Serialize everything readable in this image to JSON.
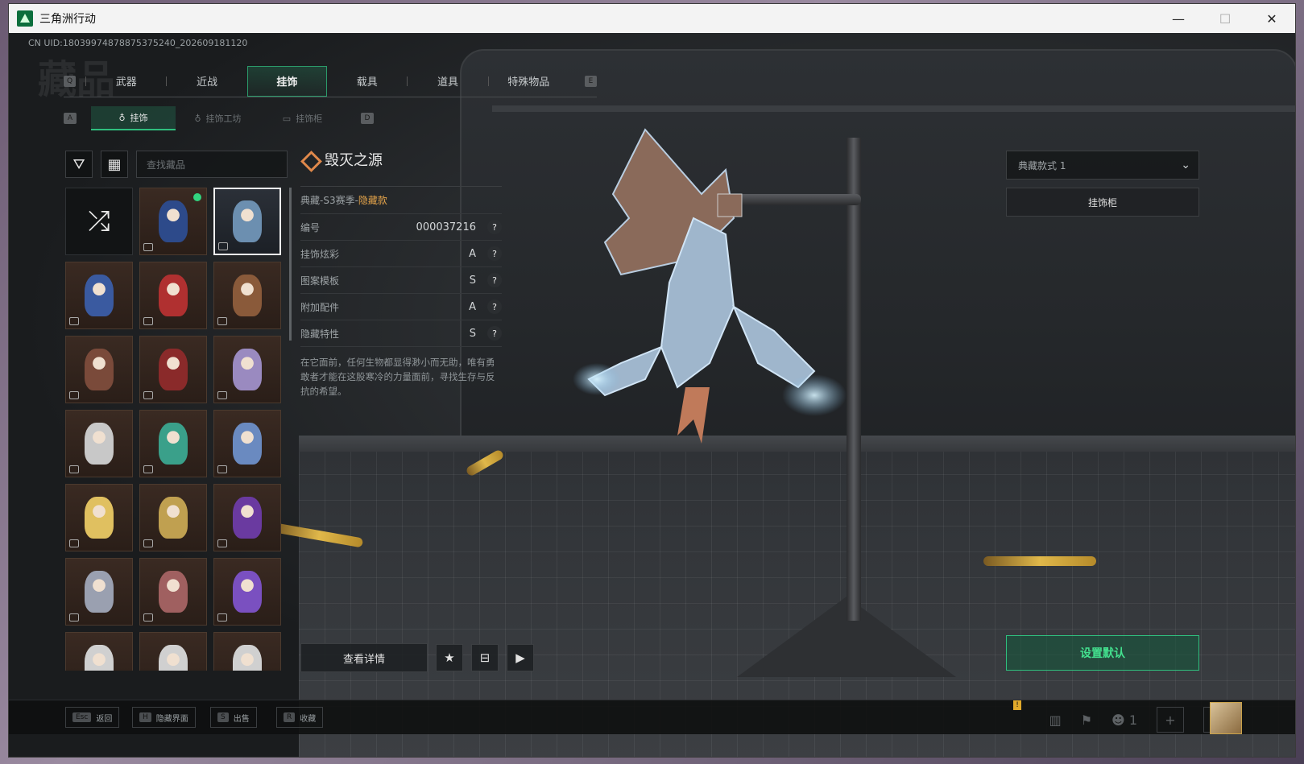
{
  "window": {
    "title": "三角洲行动",
    "controls": {
      "minimize": "—",
      "maximize": "☐",
      "close": "✕"
    }
  },
  "uid": "CN UID:18039974878875375240_202609181120",
  "bg_title": "藏品",
  "main_tabs": {
    "left_key": "Q",
    "right_key": "E",
    "items": [
      {
        "label": "武器",
        "active": false
      },
      {
        "label": "近战",
        "active": false
      },
      {
        "label": "挂饰",
        "active": true
      },
      {
        "label": "载具",
        "active": false
      },
      {
        "label": "道具",
        "active": false
      },
      {
        "label": "特殊物品",
        "active": false
      }
    ]
  },
  "sub_tabs": {
    "left_key": "A",
    "right_key": "D",
    "items": [
      {
        "label": "挂饰",
        "icon": "charm-icon",
        "active": true
      },
      {
        "label": "挂饰工坊",
        "icon": "charm-icon",
        "active": false
      },
      {
        "label": "挂饰柜",
        "icon": "cabinet-icon",
        "active": false
      }
    ]
  },
  "toolbar": {
    "filter_icon": "filter-icon",
    "layout_icon": "grid-layout-icon",
    "search_placeholder": "查找藏品"
  },
  "grid": {
    "items": [
      {
        "kind": "random",
        "icon": "shuffle-icon"
      },
      {
        "kind": "charm",
        "color": "#2d4a8a",
        "equipped": true
      },
      {
        "kind": "charm",
        "color": "#6c8fb0",
        "selected": true
      },
      {
        "kind": "charm",
        "color": "#3a5aa0"
      },
      {
        "kind": "charm",
        "color": "#b03030"
      },
      {
        "kind": "charm",
        "color": "#8a5a3a"
      },
      {
        "kind": "charm",
        "color": "#7a4a3a"
      },
      {
        "kind": "charm",
        "color": "#8a2a2a"
      },
      {
        "kind": "charm",
        "color": "#9a8ac0"
      },
      {
        "kind": "charm",
        "color": "#c8c8c8"
      },
      {
        "kind": "charm",
        "color": "#3aa08a"
      },
      {
        "kind": "charm",
        "color": "#6a8ac0"
      },
      {
        "kind": "charm",
        "color": "#e0c060"
      },
      {
        "kind": "charm",
        "color": "#c0a050"
      },
      {
        "kind": "charm",
        "color": "#6a3aa0"
      },
      {
        "kind": "charm",
        "color": "#9aa0b0"
      },
      {
        "kind": "charm",
        "color": "#a06060"
      },
      {
        "kind": "charm",
        "color": "#7a50c0"
      },
      {
        "kind": "charm",
        "color": "#d0d0d0"
      },
      {
        "kind": "charm",
        "color": "#d0d0d0"
      },
      {
        "kind": "charm",
        "color": "#d0d0d0"
      }
    ]
  },
  "detail": {
    "name": "毁灭之源",
    "season": "典藏-S3赛季-",
    "hidden_tag": "隐藏款",
    "attributes": [
      {
        "label": "编号",
        "value": "000037216"
      },
      {
        "label": "挂饰炫彩",
        "value": "A"
      },
      {
        "label": "图案模板",
        "value": "S"
      },
      {
        "label": "附加配件",
        "value": "A"
      },
      {
        "label": "隐藏特性",
        "value": "S"
      }
    ],
    "help": "?",
    "description": "在它面前，任何生物都显得渺小而无助，唯有勇敢者才能在这股寒冷的力量面前，寻找生存与反抗的希望。"
  },
  "actions": {
    "view_details": "查看详情",
    "favorite_icon": "star-icon",
    "cart_icon": "cart-icon",
    "play_icon": "play-icon"
  },
  "right_panel": {
    "style_select": "典藏款式 1",
    "cabinet_button": "挂饰柜",
    "set_default": "设置默认"
  },
  "hints": [
    {
      "key": "Esc",
      "label": "返回"
    },
    {
      "key": "H",
      "label": "隐藏界面"
    },
    {
      "key": "S",
      "label": "出售"
    },
    {
      "key": "R",
      "label": "收藏"
    }
  ],
  "status_icons": {
    "stats": "bar-chart-icon",
    "flag": "flag-icon",
    "friends": "friends-icon",
    "friends_count": "1",
    "add1": "+",
    "add2": "+",
    "warn": "!"
  }
}
